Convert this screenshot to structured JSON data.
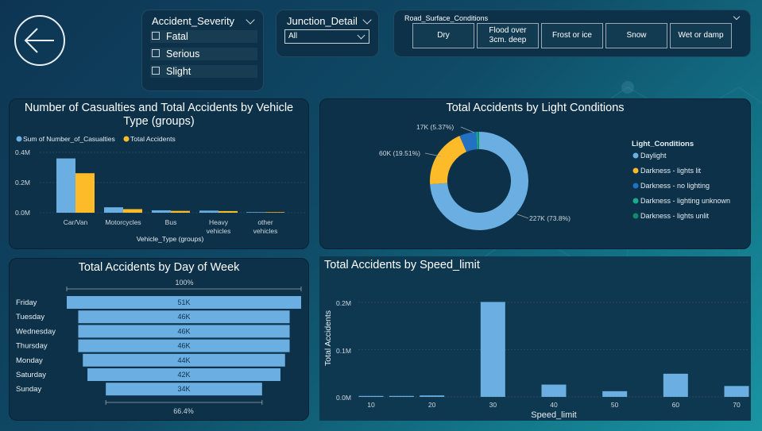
{
  "back_button": {
    "icon": "arrow-left-icon"
  },
  "slicers": {
    "severity": {
      "title": "Accident_Severity",
      "items": [
        "Fatal",
        "Serious",
        "Slight"
      ]
    },
    "junction": {
      "title": "Junction_Detail",
      "selected": "All"
    },
    "road_surface": {
      "title": "Road_Surface_Conditions",
      "tiles": [
        "Dry",
        "Flood over 3cm. deep",
        "Frost or ice",
        "Snow",
        "Wet or damp"
      ]
    }
  },
  "colors": {
    "blue": "#6aaee2",
    "yellow": "#fdbb2a",
    "navy": "#2371c2",
    "teal": "#1aab8b",
    "green": "#138a6d"
  },
  "chart_data": [
    {
      "type": "bar",
      "title": "Number of Casualties and Total Accidents by Vehicle Type (groups)",
      "xlabel": "Vehicle_Type (groups)",
      "ylabel": "",
      "categories": [
        "Car/Van",
        "Motorcycles",
        "Bus",
        "Heavy vehicles",
        "other vehicles"
      ],
      "series": [
        {
          "name": "Sum of Number_of_Casualties",
          "values": [
            360000,
            36000,
            16000,
            14000,
            4000
          ]
        },
        {
          "name": "Total Accidents",
          "values": [
            262000,
            24000,
            12000,
            11000,
            4000
          ]
        }
      ],
      "yticks": [
        "0.0M",
        "0.2M",
        "0.4M"
      ],
      "ylim": [
        0,
        400000
      ],
      "legend": "top-left"
    },
    {
      "type": "pie",
      "title": "Total Accidents by Light Conditions",
      "legend_title": "Light_Conditions",
      "categories": [
        "Daylight",
        "Darkness - lights lit",
        "Darkness - no lighting",
        "Darkness - lighting unknown",
        "Darkness - lights unlit"
      ],
      "values": [
        227000,
        60000,
        17000,
        2000,
        1000
      ],
      "data_labels": [
        "227K (73.8%)",
        "60K (19.51%)",
        "17K (5.37%)"
      ],
      "legend": "right"
    },
    {
      "type": "bar",
      "title": "Total Accidents by Day of Week",
      "orientation": "funnel",
      "categories": [
        "Friday",
        "Tuesday",
        "Wednesday",
        "Thursday",
        "Monday",
        "Saturday",
        "Sunday"
      ],
      "values": [
        51000,
        46000,
        46000,
        46000,
        44000,
        42000,
        34000
      ],
      "data_labels": [
        "51K",
        "46K",
        "46K",
        "46K",
        "44K",
        "42K",
        "34K"
      ],
      "top_label": "100%",
      "bottom_label": "66.4%"
    },
    {
      "type": "bar",
      "title": "Total Accidents by Speed_limit",
      "xlabel": "Speed_limit",
      "ylabel": "Total Accidents",
      "categories": [
        10,
        20,
        30,
        40,
        50,
        60,
        70
      ],
      "x": [
        10,
        15,
        20,
        30,
        40,
        50,
        60,
        70
      ],
      "values": [
        2000,
        2000,
        3000,
        201000,
        26000,
        12000,
        49000,
        23000
      ],
      "xticks": [
        "10",
        "20",
        "30",
        "40",
        "50",
        "60",
        "70"
      ],
      "yticks": [
        "0.0M",
        "0.1M",
        "0.2M"
      ],
      "ylim": [
        0,
        200000
      ],
      "xlim": [
        10,
        70
      ]
    }
  ]
}
